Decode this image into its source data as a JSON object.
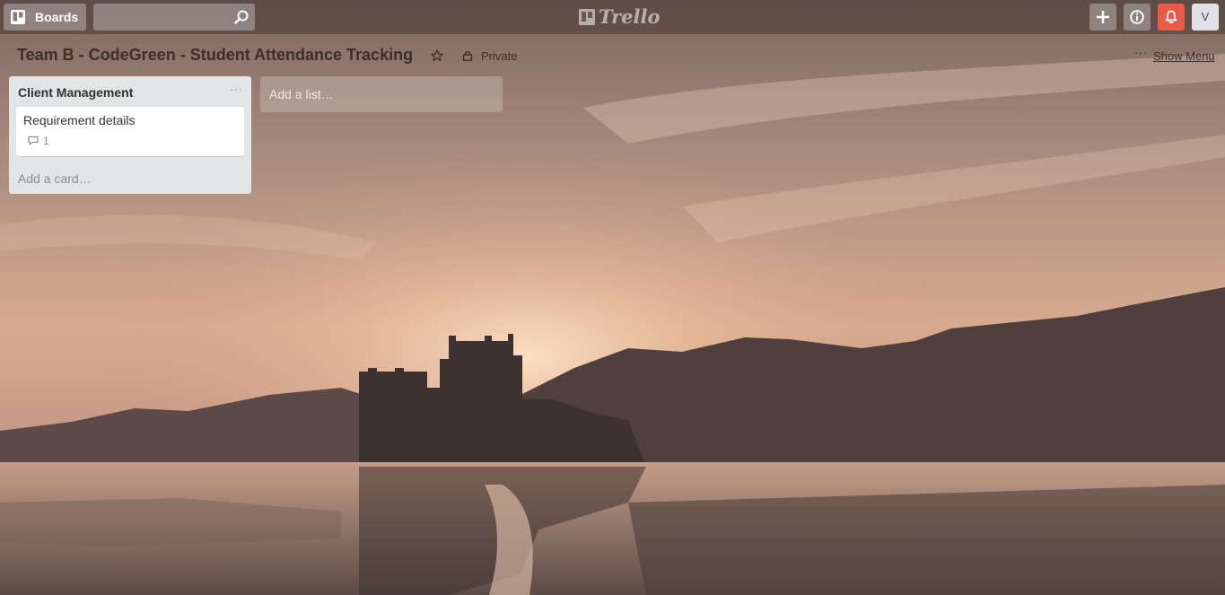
{
  "header": {
    "boards_label": "Boards",
    "search_value": "",
    "logo_text": "Trello",
    "avatar_initial": "V"
  },
  "board": {
    "title": "Team B - CodeGreen - Student Attendance Tracking",
    "visibility": "Private",
    "show_menu_label": "Show Menu",
    "menu_dots": "···"
  },
  "lists": [
    {
      "title": "Client Management",
      "menu_dots": "···",
      "cards": [
        {
          "title": "Requirement details",
          "comments": "1"
        }
      ],
      "add_card_label": "Add a card…"
    }
  ],
  "add_list_label": "Add a list…",
  "colors": {
    "notification_bell": "#eb5a46",
    "list_bg": "#e2e4e6"
  },
  "icons": [
    "boards-icon",
    "search-icon",
    "trello-logo-icon",
    "plus-icon",
    "info-icon",
    "bell-icon",
    "star-icon",
    "lock-icon",
    "comment-icon"
  ]
}
